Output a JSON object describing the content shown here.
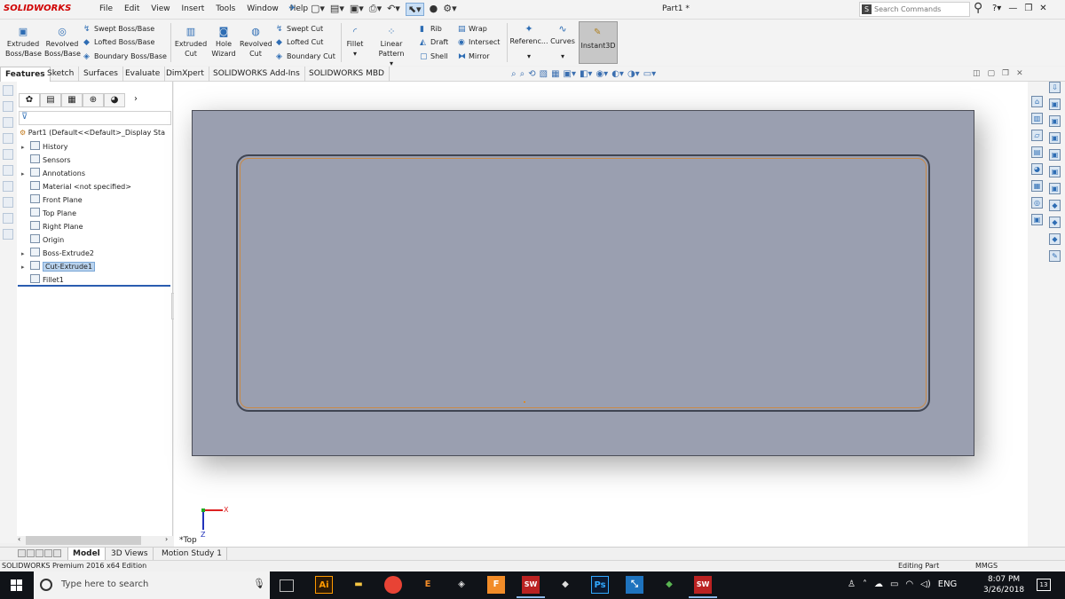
{
  "app": {
    "logo": "SOLIDWORKS",
    "document_title": "Part1 *",
    "menus": [
      "File",
      "Edit",
      "View",
      "Insert",
      "Tools",
      "Window",
      "Help"
    ]
  },
  "search": {
    "placeholder": "Search Commands"
  },
  "ribbon": {
    "extruded_boss": "Extruded Boss/Base",
    "revolved_boss": "Revolved Boss/Base",
    "swept_boss": "Swept Boss/Base",
    "lofted_boss": "Lofted Boss/Base",
    "boundary_boss": "Boundary Boss/Base",
    "extruded_cut": "Extruded Cut",
    "hole_wizard": "Hole Wizard",
    "revolved_cut": "Revolved Cut",
    "swept_cut": "Swept Cut",
    "lofted_cut": "Lofted Cut",
    "boundary_cut": "Boundary Cut",
    "fillet": "Fillet",
    "linear_pattern": "Linear Pattern",
    "rib": "Rib",
    "draft": "Draft",
    "shell": "Shell",
    "wrap": "Wrap",
    "intersect": "Intersect",
    "mirror": "Mirror",
    "reference": "Referenc...",
    "curves": "Curves",
    "instant3d": "Instant3D"
  },
  "command_tabs": [
    "Features",
    "Sketch",
    "Surfaces",
    "Evaluate",
    "DimXpert",
    "SOLIDWORKS Add-Ins",
    "SOLIDWORKS MBD"
  ],
  "feature_tree": {
    "root": "Part1  (Default<<Default>_Display Sta",
    "items": [
      {
        "label": "History",
        "expandable": true
      },
      {
        "label": "Sensors",
        "expandable": false
      },
      {
        "label": "Annotations",
        "expandable": true
      },
      {
        "label": "Material <not specified>",
        "expandable": false
      },
      {
        "label": "Front Plane",
        "expandable": false
      },
      {
        "label": "Top Plane",
        "expandable": false
      },
      {
        "label": "Right Plane",
        "expandable": false
      },
      {
        "label": "Origin",
        "expandable": false
      },
      {
        "label": "Boss-Extrude2",
        "expandable": true
      },
      {
        "label": "Cut-Extrude1",
        "expandable": true
      },
      {
        "label": "Fillet1",
        "expandable": false
      }
    ]
  },
  "graphics": {
    "view_label": "*Top",
    "axis_x": "X",
    "axis_y": "Z",
    "part_color": "#9a9fb0",
    "edge_highlight_color": "#c98a47"
  },
  "bottom_tabs": [
    "Model",
    "3D Views",
    "Motion Study 1"
  ],
  "status": {
    "edition": "SOLIDWORKS Premium 2016 x64 Edition",
    "mode": "Editing Part",
    "units": "MMGS"
  },
  "taskbar": {
    "search_placeholder": "Type here to search",
    "language": "ENG",
    "time": "8:07 PM",
    "date": "3/26/2018",
    "notifications": "13",
    "apps": [
      "Ai",
      "Ps"
    ]
  }
}
